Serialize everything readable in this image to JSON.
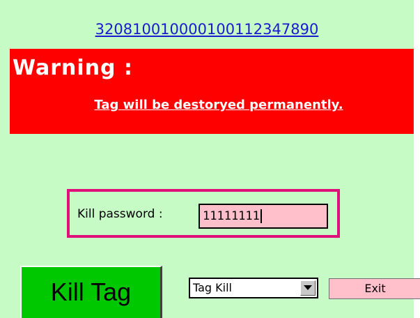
{
  "tag": {
    "id": "320810010000100112347890"
  },
  "warning": {
    "title": "Warning :",
    "message": "Tag will be destoryed permanently."
  },
  "password": {
    "label": "Kill password :",
    "value": "11111111"
  },
  "actions": {
    "kill_label": "Kill Tag",
    "mode_selected": "Tag Kill",
    "exit_label": "Exit"
  },
  "icons": {
    "dropdown": "triangle-down-icon"
  },
  "colors": {
    "background": "#c6fbc6",
    "warning": "#ff0000",
    "kill_button": "#00c800",
    "input_bg": "#ffc0cb",
    "frame": "#e0107a",
    "link": "#1a1ad0"
  }
}
